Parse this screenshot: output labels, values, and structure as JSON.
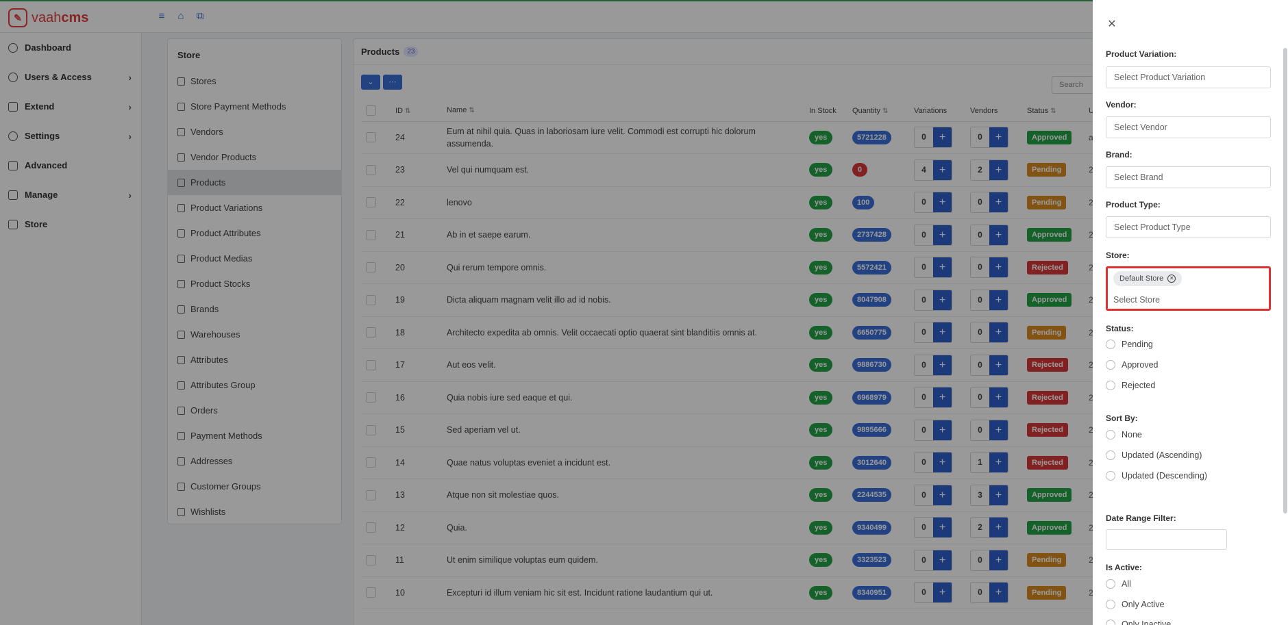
{
  "app": {
    "logo_text_light": "vaah",
    "logo_text_bold": "cms"
  },
  "left_nav": [
    {
      "label": "Dashboard",
      "has_arrow": false
    },
    {
      "label": "Users & Access",
      "has_arrow": true
    },
    {
      "label": "Extend",
      "has_arrow": true
    },
    {
      "label": "Settings",
      "has_arrow": true
    },
    {
      "label": "Advanced",
      "has_arrow": false
    },
    {
      "label": "Manage",
      "has_arrow": true
    },
    {
      "label": "Store",
      "has_arrow": false
    }
  ],
  "store_menu": {
    "title": "Store",
    "items": [
      "Stores",
      "Store Payment Methods",
      "Vendors",
      "Vendor Products",
      "Products",
      "Product Variations",
      "Product Attributes",
      "Product Medias",
      "Product Stocks",
      "Brands",
      "Warehouses",
      "Attributes",
      "Attributes Group",
      "Orders",
      "Payment Methods",
      "Addresses",
      "Customer Groups",
      "Wishlists"
    ],
    "active": "Products"
  },
  "products": {
    "title": "Products",
    "count": "23",
    "search_placeholder": "Search",
    "columns": {
      "id": "ID",
      "name": "Name",
      "in_stock": "In Stock",
      "quantity": "Quantity",
      "variations": "Variations",
      "vendors": "Vendors",
      "status": "Status",
      "updated": "U"
    },
    "rows": [
      {
        "id": "24",
        "name": "Eum at nihil quia. Quas in laboriosam iure velit. Commodi est corrupti hic dolorum assumenda.",
        "in_stock": "yes",
        "quantity": "5721228",
        "variations": "0",
        "vendors": "0",
        "status": "Approved",
        "u": "a"
      },
      {
        "id": "23",
        "name": "Vel qui numquam est.",
        "in_stock": "yes",
        "quantity": "0",
        "variations": "4",
        "vendors": "2",
        "status": "Pending",
        "u": "2"
      },
      {
        "id": "22",
        "name": "lenovo",
        "in_stock": "yes",
        "quantity": "100",
        "variations": "0",
        "vendors": "0",
        "status": "Pending",
        "u": "2"
      },
      {
        "id": "21",
        "name": "Ab in et saepe earum.",
        "in_stock": "yes",
        "quantity": "2737428",
        "variations": "0",
        "vendors": "0",
        "status": "Approved",
        "u": "2"
      },
      {
        "id": "20",
        "name": "Qui rerum tempore omnis.",
        "in_stock": "yes",
        "quantity": "5572421",
        "variations": "0",
        "vendors": "0",
        "status": "Rejected",
        "u": "2"
      },
      {
        "id": "19",
        "name": "Dicta aliquam magnam velit illo ad id nobis.",
        "in_stock": "yes",
        "quantity": "8047908",
        "variations": "0",
        "vendors": "0",
        "status": "Approved",
        "u": "2"
      },
      {
        "id": "18",
        "name": "Architecto expedita ab omnis. Velit occaecati optio quaerat sint blanditiis omnis at.",
        "in_stock": "yes",
        "quantity": "6650775",
        "variations": "0",
        "vendors": "0",
        "status": "Pending",
        "u": "2"
      },
      {
        "id": "17",
        "name": "Aut eos velit.",
        "in_stock": "yes",
        "quantity": "9886730",
        "variations": "0",
        "vendors": "0",
        "status": "Rejected",
        "u": "2"
      },
      {
        "id": "16",
        "name": "Quia nobis iure sed eaque et qui.",
        "in_stock": "yes",
        "quantity": "6968979",
        "variations": "0",
        "vendors": "0",
        "status": "Rejected",
        "u": "2"
      },
      {
        "id": "15",
        "name": "Sed aperiam vel ut.",
        "in_stock": "yes",
        "quantity": "9895666",
        "variations": "0",
        "vendors": "0",
        "status": "Rejected",
        "u": "2"
      },
      {
        "id": "14",
        "name": "Quae natus voluptas eveniet a incidunt est.",
        "in_stock": "yes",
        "quantity": "3012640",
        "variations": "0",
        "vendors": "1",
        "status": "Rejected",
        "u": "2"
      },
      {
        "id": "13",
        "name": "Atque non sit molestiae quos.",
        "in_stock": "yes",
        "quantity": "2244535",
        "variations": "0",
        "vendors": "3",
        "status": "Approved",
        "u": "2"
      },
      {
        "id": "12",
        "name": "Quia.",
        "in_stock": "yes",
        "quantity": "9340499",
        "variations": "0",
        "vendors": "2",
        "status": "Approved",
        "u": "2"
      },
      {
        "id": "11",
        "name": "Ut enim similique voluptas eum quidem.",
        "in_stock": "yes",
        "quantity": "3323523",
        "variations": "0",
        "vendors": "0",
        "status": "Pending",
        "u": "2"
      },
      {
        "id": "10",
        "name": "Excepturi id illum veniam hic sit est. Incidunt ratione laudantium qui ut.",
        "in_stock": "yes",
        "quantity": "8340951",
        "variations": "0",
        "vendors": "0",
        "status": "Pending",
        "u": "2"
      }
    ]
  },
  "filter_panel": {
    "product_variation": {
      "label": "Product Variation:",
      "placeholder": "Select Product Variation"
    },
    "vendor": {
      "label": "Vendor:",
      "placeholder": "Select Vendor"
    },
    "brand": {
      "label": "Brand:",
      "placeholder": "Select Brand"
    },
    "product_type": {
      "label": "Product Type:",
      "placeholder": "Select Product Type"
    },
    "store": {
      "label": "Store:",
      "chip": "Default Store",
      "placeholder": "Select Store"
    },
    "status": {
      "label": "Status:",
      "options": [
        "Pending",
        "Approved",
        "Rejected"
      ]
    },
    "sort_by": {
      "label": "Sort By:",
      "options": [
        "None",
        "Updated (Ascending)",
        "Updated (Descending)"
      ]
    },
    "date_range": {
      "label": "Date Range Filter:"
    },
    "is_active": {
      "label": "Is Active:",
      "options": [
        "All",
        "Only Active",
        "Only Inactive"
      ]
    }
  }
}
